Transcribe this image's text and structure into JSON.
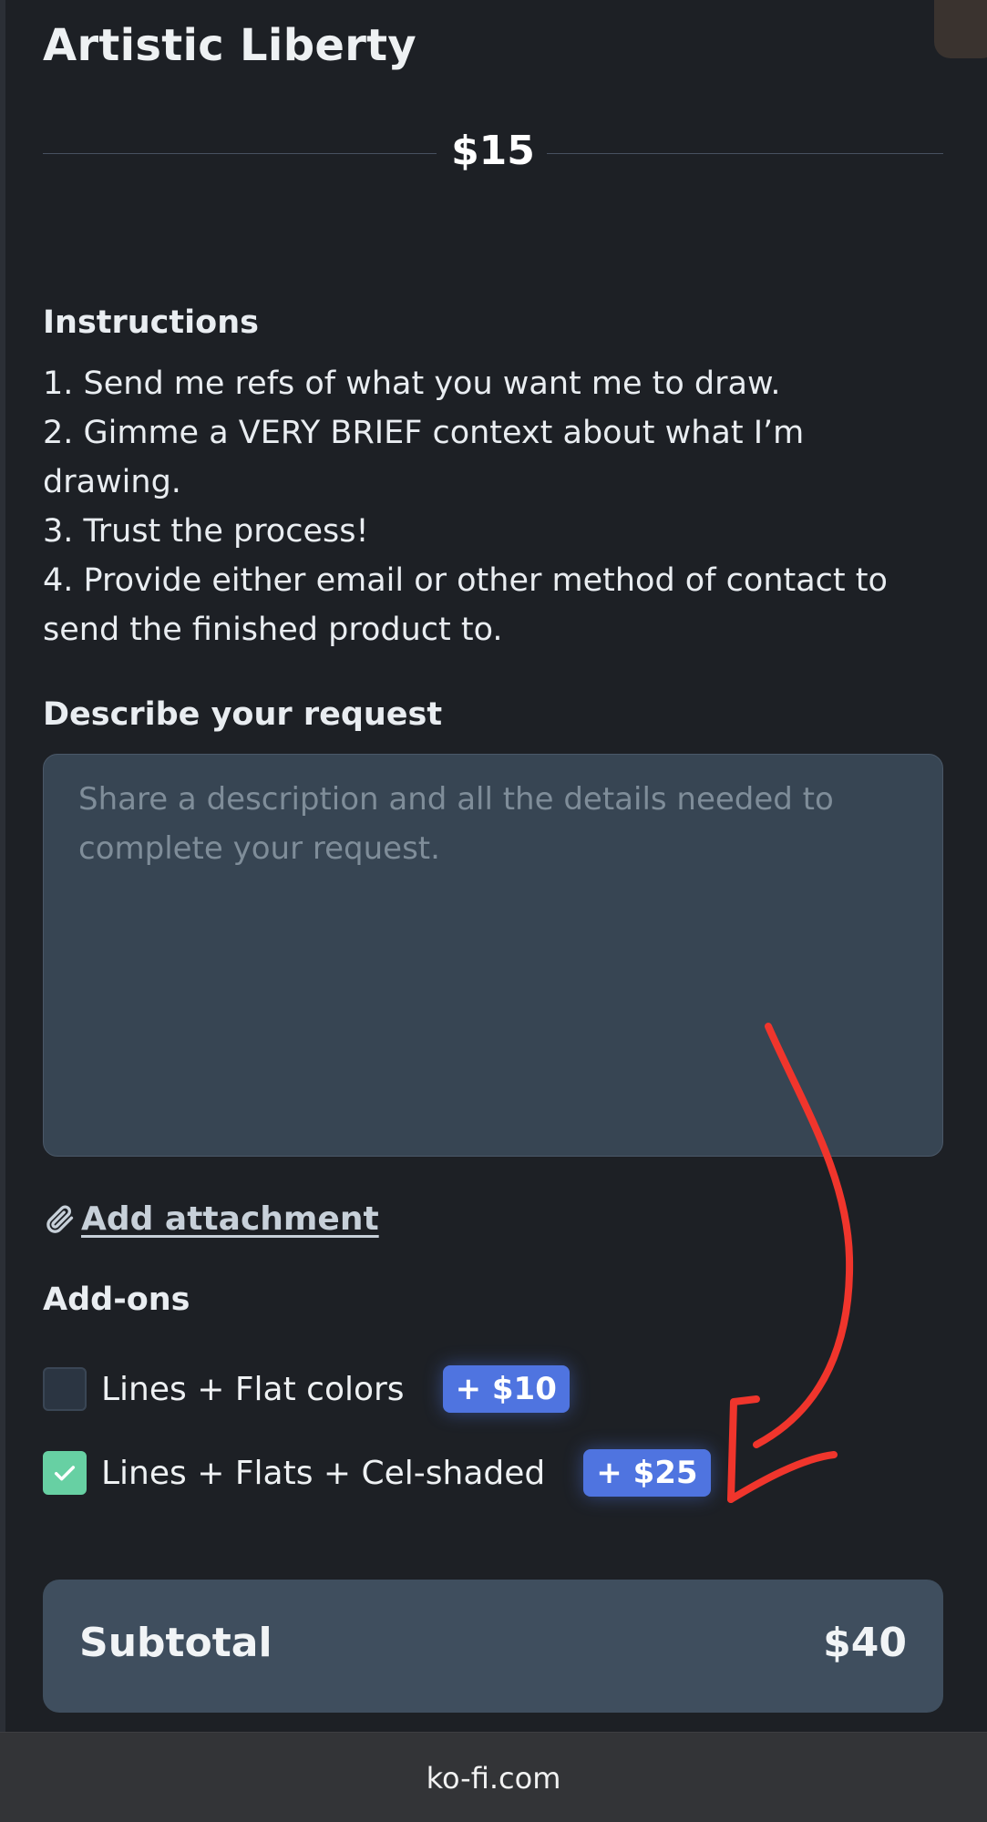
{
  "page": {
    "title": "Artistic Liberty",
    "price": "$15"
  },
  "instructions": {
    "heading": "Instructions",
    "lines": [
      "1. Send me refs of what you want me to draw.",
      "2. Gimme a VERY BRIEF context about what I’m",
      "drawing.",
      "3. Trust the process!",
      "4. Provide either email or other method of contact to",
      "send the finished product to."
    ]
  },
  "request": {
    "heading": "Describe your request",
    "value": "",
    "placeholder": "Share a description and all the details needed to complete your request."
  },
  "attachment": {
    "label": "Add attachment",
    "icon": "paperclip-icon"
  },
  "addons": {
    "heading": "Add-ons",
    "items": [
      {
        "label": "Lines + Flat colors",
        "price": "+ $10",
        "checked": false
      },
      {
        "label": "Lines + Flats + Cel-shaded",
        "price": "+ $25",
        "checked": true
      }
    ]
  },
  "subtotal": {
    "label": "Subtotal",
    "value": "$40"
  },
  "browser": {
    "url": "ko-fi.com"
  },
  "colors": {
    "background": "#1d2025",
    "accent_badge": "#4f74e0",
    "checkbox_checked": "#67d0a3",
    "annotation_red": "#f0352c"
  }
}
